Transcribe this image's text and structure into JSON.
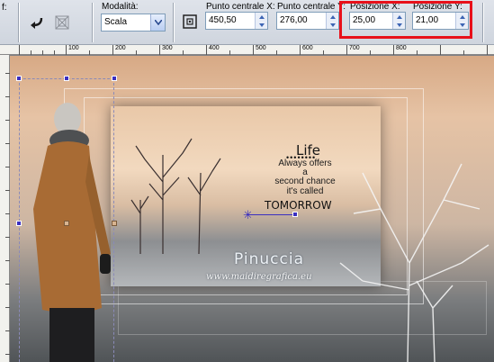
{
  "toolbar": {
    "left_label": "f:",
    "mode": {
      "label": "Modalità:",
      "value": "Scala"
    },
    "center_x": {
      "label": "Punto centrale X:",
      "value": "450,50"
    },
    "center_y": {
      "label": "Punto centrale Y:",
      "value": "276,00"
    },
    "pos_x": {
      "label": "Posizione X:",
      "value": "25,00"
    },
    "pos_y": {
      "label": "Posizione Y:",
      "value": "21,00"
    },
    "highlight_color": "#e8101a",
    "icons": [
      "return-arrow-icon",
      "pick-tool-icon",
      "center-point-icon"
    ]
  },
  "ruler": {
    "labels": [
      "100",
      "200",
      "300",
      "400",
      "500",
      "600",
      "700",
      "800"
    ]
  },
  "canvas": {
    "headline": "Life",
    "dots": "••••••••",
    "lines": [
      "Always offers",
      "a",
      "second chance",
      "it's called"
    ],
    "tomorrow": "TOMORROW",
    "signature": "Pinuccia",
    "url": "www.maidiregrafica.eu",
    "handle_color": "#3a2fc0"
  }
}
